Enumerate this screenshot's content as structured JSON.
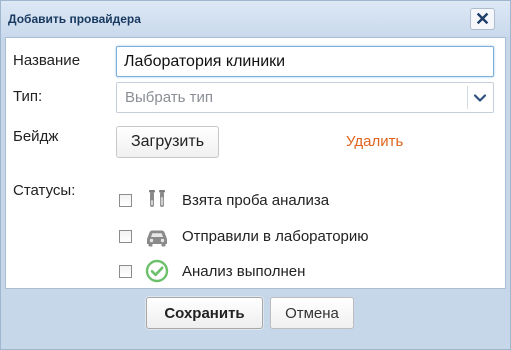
{
  "dialog": {
    "title": "Добавить провайдера",
    "close_icon": "close-icon"
  },
  "form": {
    "name_label": "Название",
    "name_value": "Лаборатория клиники",
    "type_label": "Тип:",
    "type_placeholder": "Выбрать тип",
    "type_icon": "chevron-down-icon",
    "badge_label": "Бейдж",
    "upload_label": "Загрузить",
    "delete_label": "Удалить",
    "statuses_label": "Статусы:"
  },
  "statuses": [
    {
      "label": "Взята проба анализа",
      "icon": "test-tubes-icon",
      "checked": false
    },
    {
      "label": "Отправили в лабораторию",
      "icon": "car-icon",
      "checked": false
    },
    {
      "label": "Анализ выполнен",
      "icon": "check-circle-icon",
      "checked": false
    }
  ],
  "footer": {
    "save_label": "Сохранить",
    "cancel_label": "Отмена"
  },
  "colors": {
    "accent_link": "#e0641d",
    "title_text": "#17385f",
    "focus_border": "#7eb0de",
    "check_green": "#5cb85c"
  }
}
